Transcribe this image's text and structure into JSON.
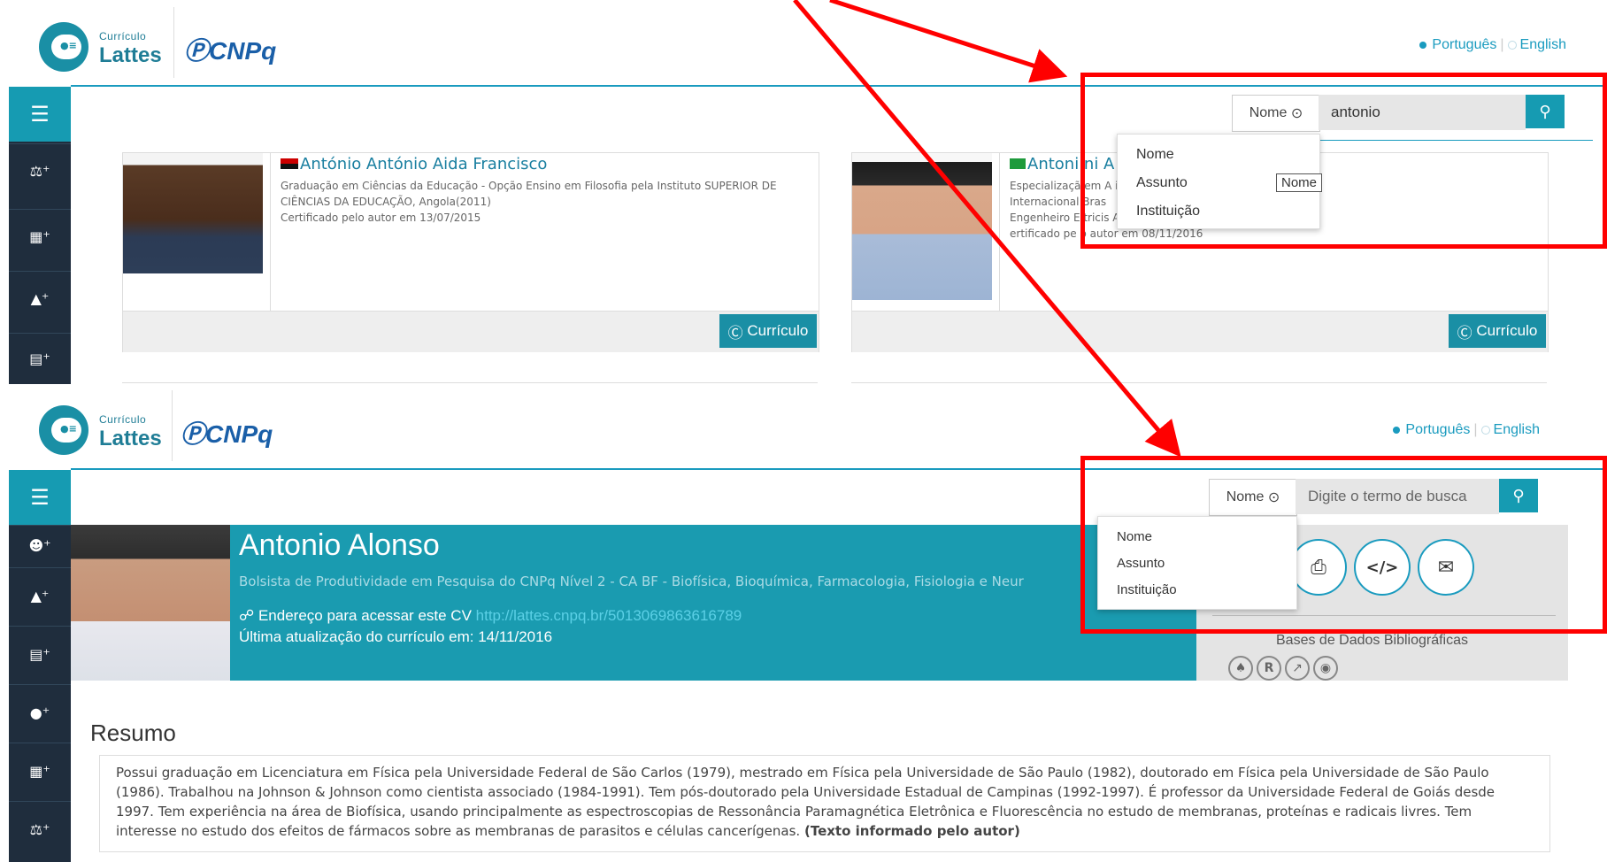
{
  "top": {
    "logo_small": "Currículo",
    "logo_big": "Lattes",
    "cnpq": "CNPq",
    "lang_pt": "Português",
    "lang_en": "English",
    "search_select": "Nome",
    "search_value": "antonio",
    "dropdown": [
      "Nome",
      "Assunto",
      "Instituição"
    ],
    "tooltip": "Nome",
    "cards": [
      {
        "flag": "angola",
        "name": "António António Aida Francisco",
        "lines": [
          "Graduação em Ciências da Educação - Opção Ensino em Filosofia pela Instituto SUPERIOR DE",
          "CIÊNCIAS DA EDUCAÇÃO, Angola(2011)",
          "Certificado pelo autor em 13/07/2015"
        ],
        "button": "Currículo"
      },
      {
        "flag": "brazil",
        "name": "Antoni ni A",
        "lines": [
          "Especializaçã em A idades pela Centro Universitário",
          "Internacional Bras",
          "Engenheiro E tricis A INDUSTRIAL ME, Brasil",
          "ertificado pe o autor em 08/11/2016"
        ],
        "button": "Currículo"
      }
    ]
  },
  "bottom": {
    "logo_small": "Currículo",
    "logo_big": "Lattes",
    "cnpq": "CNPq",
    "lang_pt": "Português",
    "lang_en": "English",
    "search_select": "Nome",
    "search_placeholder": "Digite o termo de busca",
    "dropdown": [
      "Nome",
      "Assunto",
      "Instituição"
    ],
    "profile": {
      "name": "Antonio Alonso",
      "role": "Bolsista de Produtividade em Pesquisa do CNPq Nível 2 - CA BF - Biofísica, Bioquímica, Farmacologia, Fisiologia e Neur",
      "address_label": "Endereço para acessar este CV",
      "address_url": "http://lattes.cnpq.br/5013069863616789",
      "updated": "Última atualização do currículo em: 14/11/2016"
    },
    "bases_label": "Bases de Dados Bibliográficas",
    "resumo_title": "Resumo",
    "resumo_text": "Possui graduação em Licenciatura em Física pela Universidade Federal de São Carlos (1979), mestrado em Física pela Universidade de São Paulo (1982), doutorado em Física pela Universidade de São Paulo (1986). Trabalhou na Johnson & Johnson como cientista associado (1984-1991). Tem pós-doutorado pela Universidade Estadual de Campinas (1992-1997). É professor da Universidade Federal de Goiás desde 1997. Tem experiência na área de Biofísica, usando principalmente as espectroscopias de Ressonância Paramagnética Eletrônica e Fluorescência no estudo de membranas, proteínas e radicais livres. Tem interesse no estudo dos efeitos de fármacos sobre as membranas de parasitos e células cancerígenas.",
    "resumo_author": "(Texto informado pelo autor)"
  },
  "colors": {
    "teal": "#169bb2",
    "sidebar": "#1f2d3d",
    "annotation": "#ff0000"
  }
}
